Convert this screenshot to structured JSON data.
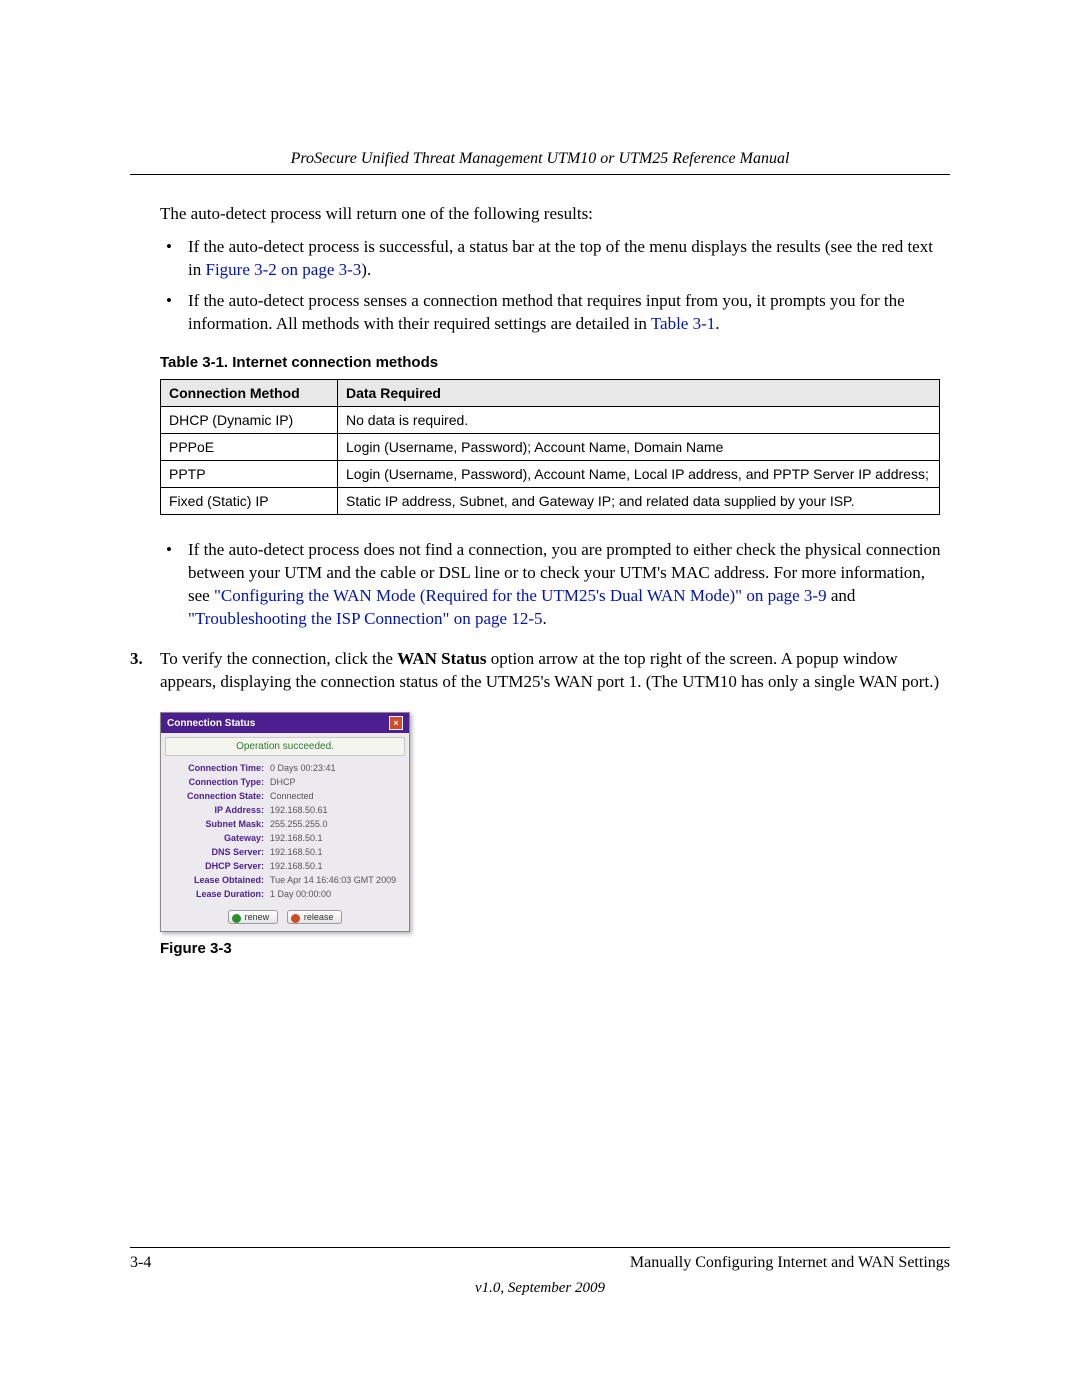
{
  "header": {
    "running": "ProSecure Unified Threat Management UTM10 or UTM25 Reference Manual"
  },
  "intro": "The auto-detect process will return one of the following results:",
  "bullets1": {
    "b0a": "If the auto-detect process is successful, a status bar at the top of the menu displays the results (see the red text in ",
    "b0link": "Figure 3-2 on page 3-3",
    "b0b": ").",
    "b1a": "If the auto-detect process senses a connection method that requires input from you, it prompts you for the information. All methods with their required settings are detailed in ",
    "b1link": "Table 3-1",
    "b1b": "."
  },
  "table": {
    "caption": "Table 3-1. Internet connection methods",
    "h1": "Connection Method",
    "h2": "Data Required",
    "rows": [
      {
        "m": "DHCP (Dynamic IP)",
        "d": "No data is required."
      },
      {
        "m": "PPPoE",
        "d": "Login (Username, Password); Account Name, Domain Name"
      },
      {
        "m": "PPTP",
        "d": "Login (Username, Password), Account Name, Local IP address, and PPTP Server IP address;"
      },
      {
        "m": "Fixed (Static) IP",
        "d": "Static IP address, Subnet, and Gateway IP; and related data supplied by your ISP."
      }
    ]
  },
  "bullets2": {
    "b0a": "If the auto-detect process does not find a connection, you are prompted to either check the physical connection between your UTM and the cable or DSL line or to check your UTM's MAC address. For more information, see ",
    "b0link1": "\"Configuring the WAN Mode (Required for the UTM25's Dual WAN Mode)\" on page 3-9",
    "b0mid": " and ",
    "b0link2": "\"Troubleshooting the ISP Connection\" on page 12-5",
    "b0b": "."
  },
  "step3": {
    "num": "3.",
    "a": "To verify the connection, click the ",
    "bold": "WAN Status",
    "b": " option arrow at the top right of the screen. A popup window appears, displaying the connection status of the UTM25's WAN port 1. (The UTM10 has only a single WAN port.)"
  },
  "status": {
    "title": "Connection Status",
    "msg": "Operation succeeded.",
    "rows": [
      {
        "l": "Connection Time:",
        "v": "0 Days 00:23:41"
      },
      {
        "l": "Connection Type:",
        "v": "DHCP"
      },
      {
        "l": "Connection State:",
        "v": "Connected"
      },
      {
        "l": "IP Address:",
        "v": "192.168.50.61"
      },
      {
        "l": "Subnet Mask:",
        "v": "255.255.255.0"
      },
      {
        "l": "Gateway:",
        "v": "192.168.50.1"
      },
      {
        "l": "DNS Server:",
        "v": "192.168.50.1"
      },
      {
        "l": "DHCP Server:",
        "v": "192.168.50.1"
      },
      {
        "l": "Lease Obtained:",
        "v": "Tue Apr 14 16:46:03 GMT 2009"
      },
      {
        "l": "Lease Duration:",
        "v": "1 Day 00:00:00"
      }
    ],
    "btn_renew": "renew",
    "btn_release": "release"
  },
  "figure_caption": "Figure 3-3",
  "footer": {
    "pagenum": "3-4",
    "chapter": "Manually Configuring Internet and WAN Settings",
    "version": "v1.0, September 2009"
  }
}
